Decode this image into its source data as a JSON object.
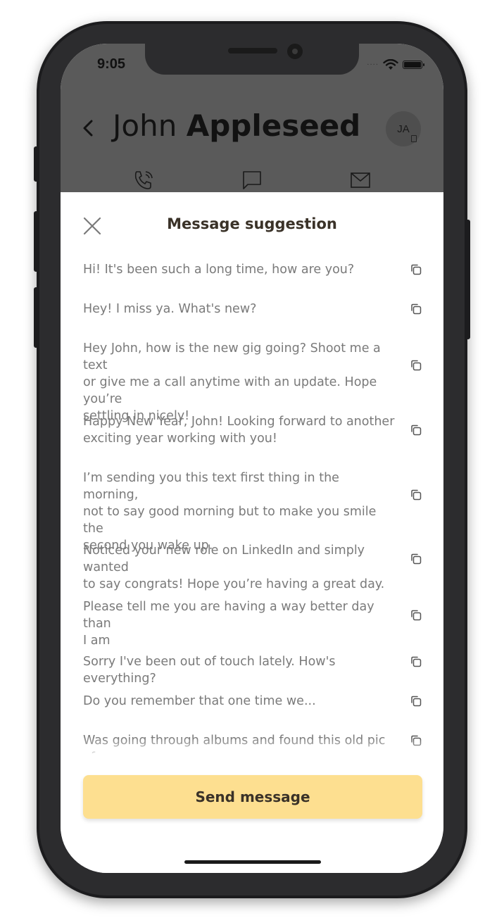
{
  "status_bar": {
    "time": "9:05"
  },
  "contact": {
    "first_name": "John",
    "last_name": "Appleseed",
    "initials": "JA"
  },
  "sheet": {
    "title": "Message suggestion",
    "suggestions": [
      {
        "lines": [
          "Hi! It's been such a long time, how are you?"
        ]
      },
      {
        "lines": [
          "Hey! I miss ya. What's new?"
        ]
      },
      {
        "lines": [
          "Hey John, how is the new gig going? Shoot me a text",
          "or give me a call anytime with an update. Hope you’re",
          "settling in nicely!"
        ]
      },
      {
        "lines": [
          "Happy New Year, John! Looking forward to another",
          "exciting year working with you!"
        ]
      },
      {
        "lines": [
          "I’m sending you this text first thing in the morning,",
          "not to say good morning but to make you smile the",
          "second you wake up."
        ]
      },
      {
        "lines": [
          "Noticed your new role on LinkedIn and simply wanted",
          "to say congrats! Hope you’re having a great day."
        ]
      },
      {
        "lines": [
          "Please tell me you are having a way better day than",
          "I am"
        ]
      },
      {
        "lines": [
          "Sorry I've been out of touch lately. How's everything?"
        ]
      },
      {
        "lines": [
          "Do you remember that one time we..."
        ]
      },
      {
        "lines": [
          "Was going through albums and found this old pic of"
        ]
      }
    ],
    "send_button_label": "Send message"
  },
  "colors": {
    "send_button": "#fddf90",
    "title_text": "#3a3228",
    "suggestion_text": "#7a7a7a",
    "dim_overlay": "#5a5a5a"
  }
}
